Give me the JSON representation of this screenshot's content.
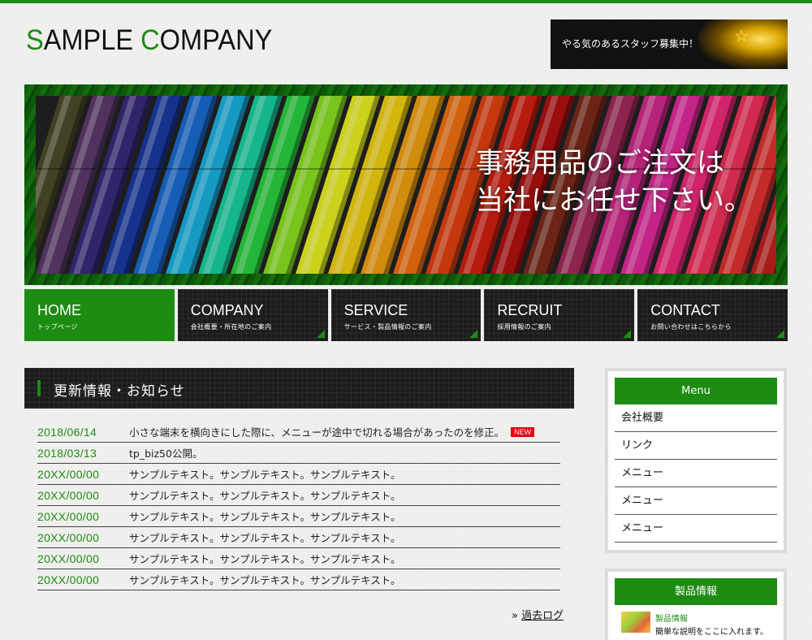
{
  "header": {
    "logo_first": "S",
    "logo_mid": "AMPLE ",
    "logo_second": "C",
    "logo_rest": "OMPANY",
    "recruit_banner_text": "やる気のあるスタッフ募集中！"
  },
  "hero": {
    "line1": "事務用品のご注文は",
    "line2": "当社にお任せ下さい。"
  },
  "nav": [
    {
      "en": "HOME",
      "ja": "トップページ"
    },
    {
      "en": "COMPANY",
      "ja": "会社概要・所在地のご案内"
    },
    {
      "en": "SERVICE",
      "ja": "サービス・製品情報のご案内"
    },
    {
      "en": "RECRUIT",
      "ja": "採用情報のご案内"
    },
    {
      "en": "CONTACT",
      "ja": "お問い合わせはこちらから"
    }
  ],
  "news": {
    "title": "更新情報・お知らせ",
    "items": [
      {
        "date": "2018/06/14",
        "text": "小さな端末を横向きにした際に、メニューが途中で切れる場合があったのを修正。",
        "badge": "NEW"
      },
      {
        "date": "2018/03/13",
        "text": "tp_biz50公開。"
      },
      {
        "date": "20XX/00/00",
        "text": "サンプルテキスト。サンプルテキスト。サンプルテキスト。"
      },
      {
        "date": "20XX/00/00",
        "text": "サンプルテキスト。サンプルテキスト。サンプルテキスト。"
      },
      {
        "date": "20XX/00/00",
        "text": "サンプルテキスト。サンプルテキスト。サンプルテキスト。"
      },
      {
        "date": "20XX/00/00",
        "text": "サンプルテキスト。サンプルテキスト。サンプルテキスト。"
      },
      {
        "date": "20XX/00/00",
        "text": "サンプルテキスト。サンプルテキスト。サンプルテキスト。"
      },
      {
        "date": "20XX/00/00",
        "text": "サンプルテキスト。サンプルテキスト。サンプルテキスト。"
      }
    ],
    "archive_prefix": "»",
    "archive_label": "過去ログ"
  },
  "sidebar": {
    "menu_title": "Menu",
    "menu_items": [
      "会社概要",
      "リンク",
      "メニュー",
      "メニュー",
      "メニュー"
    ],
    "products_title": "製品情報",
    "product_name": "製品情報",
    "product_desc": "簡単な説明をここに入れます。"
  },
  "colors": {
    "accent": "#1d8c12",
    "dark": "#1c1c1c",
    "new_badge": "#e60012"
  }
}
